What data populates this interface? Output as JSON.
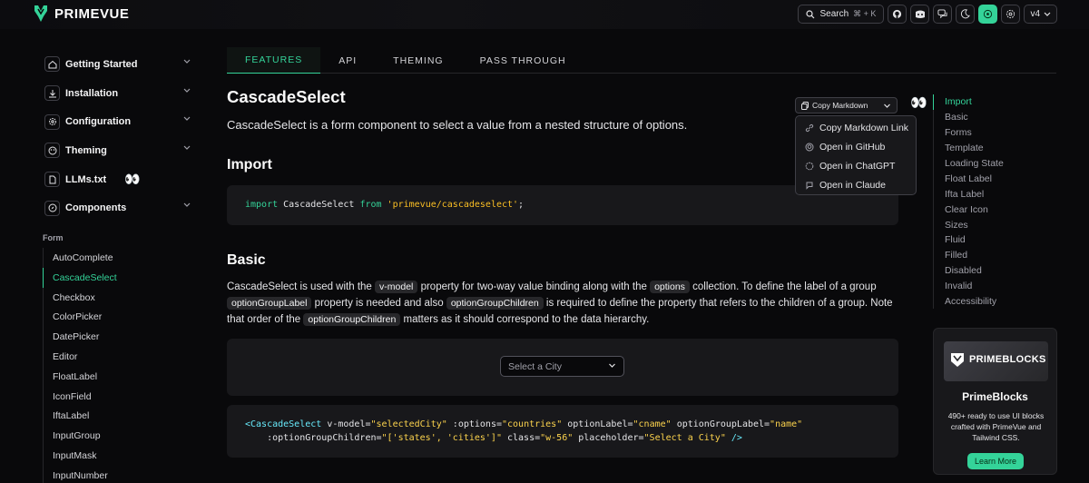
{
  "header": {
    "logo_text": "PRIMEVUE",
    "search_label": "Search",
    "search_shortcut": "⌘ + K",
    "version": "v4"
  },
  "sidebar": {
    "groups": [
      {
        "label": "Getting Started",
        "icon": "home-icon"
      },
      {
        "label": "Installation",
        "icon": "download-icon"
      },
      {
        "label": "Configuration",
        "icon": "gear-icon"
      },
      {
        "label": "Theming",
        "icon": "palette-icon"
      },
      {
        "label": "LLMs.txt",
        "icon": "file-icon"
      },
      {
        "label": "Components",
        "icon": "compass-icon"
      }
    ],
    "llms_emoji": "👀",
    "section": "Form",
    "items": [
      "AutoComplete",
      "CascadeSelect",
      "Checkbox",
      "ColorPicker",
      "DatePicker",
      "Editor",
      "FloatLabel",
      "IconField",
      "IftaLabel",
      "InputGroup",
      "InputMask",
      "InputNumber"
    ],
    "active_item": "CascadeSelect"
  },
  "tabs": [
    "FEATURES",
    "API",
    "THEMING",
    "PASS THROUGH"
  ],
  "main": {
    "title": "CascadeSelect",
    "lead": "CascadeSelect is a form component to select a value from a nested structure of options.",
    "import_heading": "Import",
    "import_code": {
      "kw1": "import",
      "name": " CascadeSelect ",
      "kw2": "from",
      "path": " 'primevue/cascadeselect'",
      "end": ";"
    },
    "basic_heading": "Basic",
    "basic_p1": "CascadeSelect is used with the ",
    "chip_vmodel": "v-model",
    "basic_p2": " property for two-way value binding along with the ",
    "chip_options": "options",
    "basic_p3": " collection. To define the label of a group ",
    "chip_ogl": "optionGroupLabel",
    "basic_p4": " property is needed and also ",
    "chip_ogc": "optionGroupChildren",
    "basic_p5": " is required to define the property that refers to the children of a group. Note that order of the ",
    "chip_ogc2": "optionGroupChildren",
    "basic_p6": " matters as it should correspond to the data hierarchy.",
    "select_placeholder": "Select a City",
    "code2": {
      "open": "<CascadeSelect",
      "a1": " v-model=",
      "v1": "\"selectedCity\"",
      "a2": " :options=",
      "v2": "\"countries\"",
      "a3": " optionLabel=",
      "v3": "\"cname\"",
      "a4": " optionGroupLabel=",
      "v4": "\"name\"",
      "a5": "    :optionGroupChildren=",
      "v5": "\"['states', 'cities']\"",
      "a6": " class=",
      "v6": "\"w-56\"",
      "a7": " placeholder=",
      "v7": "\"Select a City\"",
      "close": " />"
    }
  },
  "copy_markdown": {
    "label": "Copy Markdown",
    "emoji": "👀",
    "menu": [
      {
        "label": "Copy Markdown Link",
        "icon": "link-icon"
      },
      {
        "label": "Open in GitHub",
        "icon": "github-icon"
      },
      {
        "label": "Open in ChatGPT",
        "icon": "chatgpt-icon"
      },
      {
        "label": "Open in Claude",
        "icon": "claude-icon"
      }
    ]
  },
  "toc": [
    "Import",
    "Basic",
    "Forms",
    "Template",
    "Loading State",
    "Float Label",
    "Ifta Label",
    "Clear Icon",
    "Sizes",
    "Fluid",
    "Filled",
    "Disabled",
    "Invalid",
    "Accessibility"
  ],
  "promo": {
    "logo_text": "PRIMEBLOCKS",
    "title": "PrimeBlocks",
    "text": "490+ ready to use UI blocks crafted with PrimeVue and Tailwind CSS.",
    "button": "Learn More"
  },
  "colors": {
    "accent": "#34d399",
    "background": "#09090b",
    "surface": "#18181b"
  }
}
